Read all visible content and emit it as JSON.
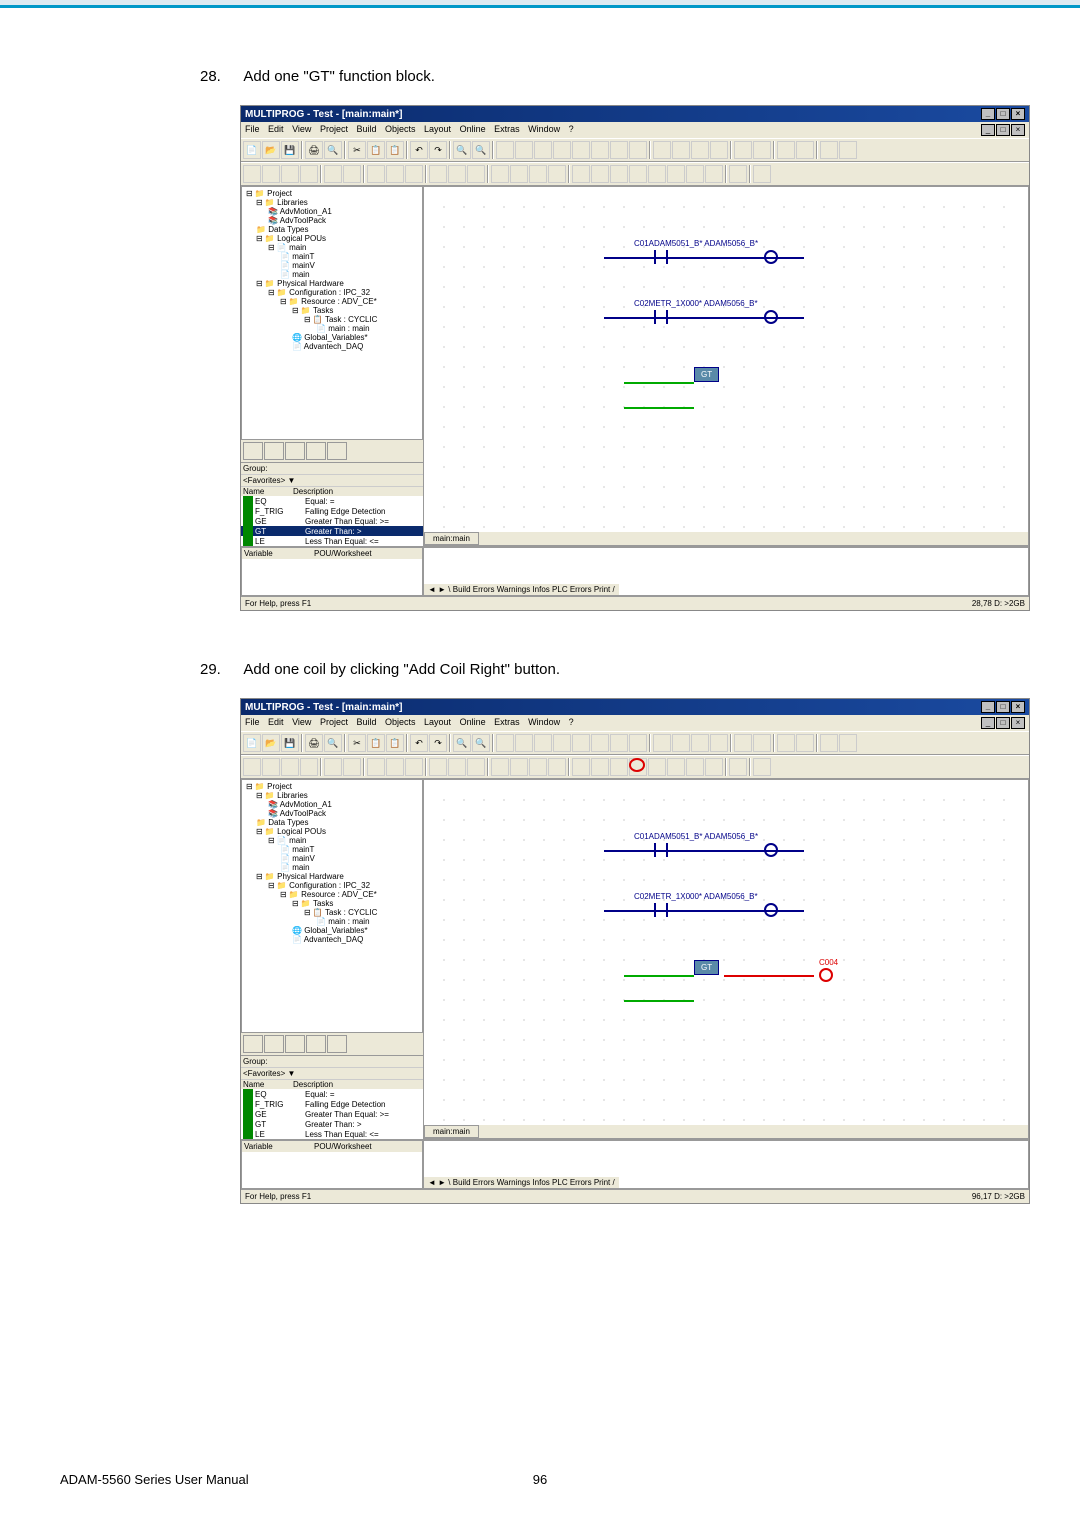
{
  "doc": {
    "step28_num": "28.",
    "step28_text": "Add one \"GT\" function block.",
    "step29_num": "29.",
    "step29_text": "Add one coil by clicking \"Add Coil Right\" button.",
    "footer_left": "ADAM-5560 Series User Manual",
    "footer_page": "96"
  },
  "app": {
    "title": "MULTIPROG - Test - [main:main*]",
    "menus": [
      "File",
      "Edit",
      "View",
      "Project",
      "Build",
      "Objects",
      "Layout",
      "Online",
      "Extras",
      "Window",
      "?"
    ],
    "status_left": "For Help, press F1",
    "status_right1": "28,78  D: >2GB",
    "status_right2": "96,17  D: >2GB",
    "worksheet_tab": "main:main",
    "output_tabs": "Build   Errors   Warnings   Infos   PLC Errors   Print"
  },
  "tree": {
    "root": "Project",
    "libraries": "Libraries",
    "lib1": "AdvMotion_A1",
    "lib2": "AdvToolPack",
    "datatypes": "Data Types",
    "logical": "Logical POUs",
    "main": "main",
    "mainT": "mainT",
    "mainV": "mainV",
    "mainc": "main",
    "physical": "Physical Hardware",
    "config": "Configuration : IPC_32",
    "resource": "Resource : ADV_CE*",
    "tasks": "Tasks",
    "task1": "Task : CYCLIC",
    "task1main": "main : main",
    "globalvars": "Global_Variables*",
    "advantech": "Advantech_DAQ"
  },
  "group": {
    "label": "Group:",
    "favorites": "<Favorites>",
    "col_name": "Name",
    "col_desc": "Description",
    "eq_name": "EQ",
    "eq_desc": "Equal: =",
    "ftrig_name": "F_TRIG",
    "ftrig_desc": "Falling Edge Detection",
    "ge_name": "GE",
    "ge_desc": "Greater Than Equal: >=",
    "gt_name": "GT",
    "gt_desc": "Greater Than: >",
    "le_name": "LE",
    "le_desc": "Less Than Equal: <="
  },
  "vars": {
    "col1": "Variable",
    "col2": "POU/Worksheet"
  },
  "ladder": {
    "contact1": "C01ADAM5051_B*  ADAM5056_B*",
    "contact2": "C02METR_1X000*  ADAM5056_B*",
    "gt_block": "GT",
    "coil_label": "C004"
  }
}
